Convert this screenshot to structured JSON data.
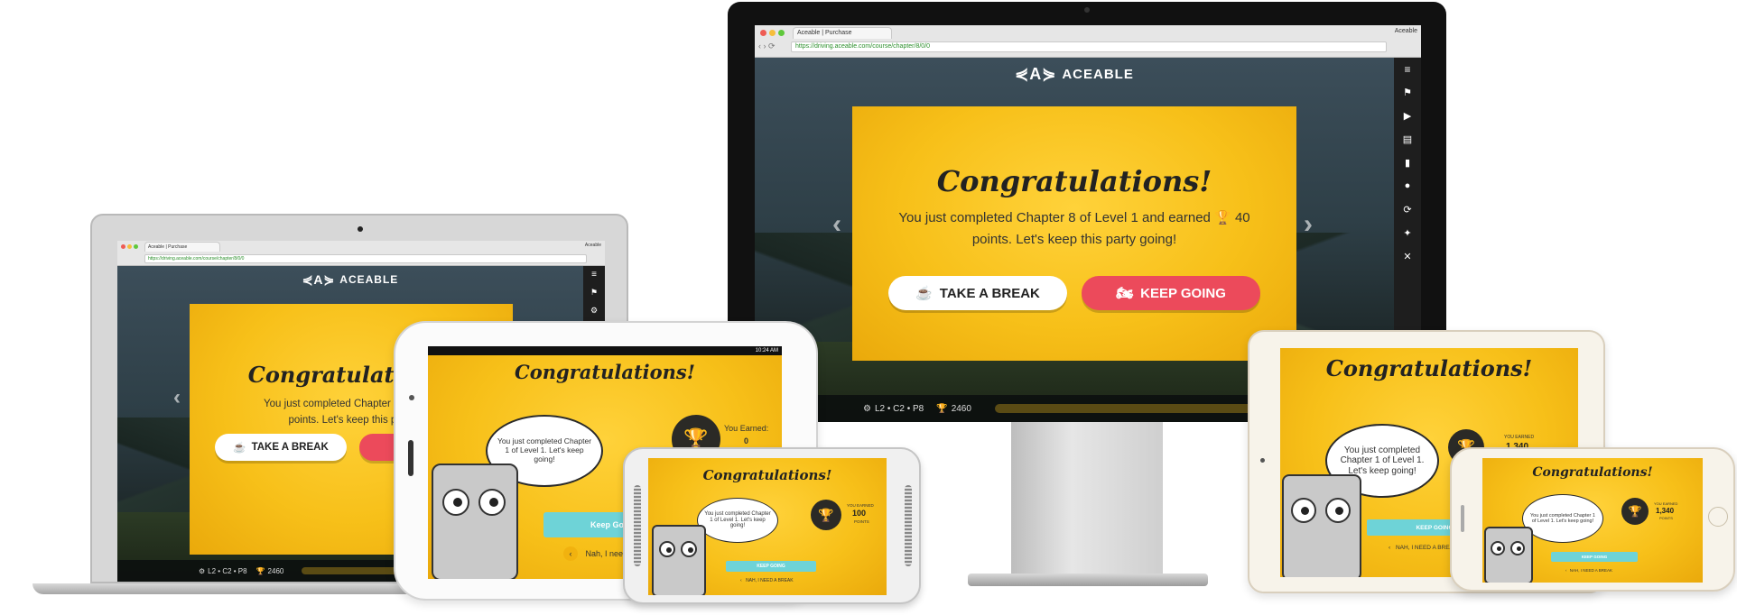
{
  "app": {
    "brand": "ACEABLE",
    "tab_title": "Aceable | Purchase",
    "tab_label_right": "Aceable",
    "url": "https://driving.aceable.com/course/chapter/8/0/0"
  },
  "celebration": {
    "title": "Congratulations!",
    "message_line1": "You just completed Chapter 8 of Level 1 and earned",
    "points": "40",
    "message_line2": "points. Let's keep this party going!",
    "laptop_message_line1": "You just completed Chapter 8 of Level",
    "laptop_message_line2": "points. Let's keep this party",
    "take_break_label": "TAKE A BREAK",
    "keep_going_label": "KEEP GOING"
  },
  "progress": {
    "level_label": "L2 • C2 • P8",
    "score": "2460"
  },
  "sidebar_icons": [
    "menu-icon",
    "flag-icon",
    "play-icon",
    "book-icon",
    "bookmark-icon",
    "user-icon",
    "refresh-icon",
    "lightbulb-icon",
    "close-icon"
  ],
  "mobile": {
    "title": "Congratulations!",
    "bubble_chapter8": "You just completed Chapter 1 of Level 1. Let's keep going!",
    "bubble_chapter1": "You just completed Chapter 1 of Level 1. Let's keep going!",
    "earned_label": "You Earned:",
    "earned_value_tablet": "0",
    "you_earned_caps": "YOU EARNED",
    "earned_value_phone": "100",
    "earned_value_ipad": "1,340",
    "points_label": "POINTS",
    "keep_going_label": "Keep Going",
    "keep_going_caps": "KEEP GOING",
    "need_break_label": "Nah, I need a break",
    "need_break_caps": "NAH, I NEED A BREAK",
    "status_time": "10:24 AM"
  },
  "colors": {
    "accent_yellow": "#f7c019",
    "keep_going_red": "#ec4a5b",
    "teal": "#6ed3d7"
  }
}
